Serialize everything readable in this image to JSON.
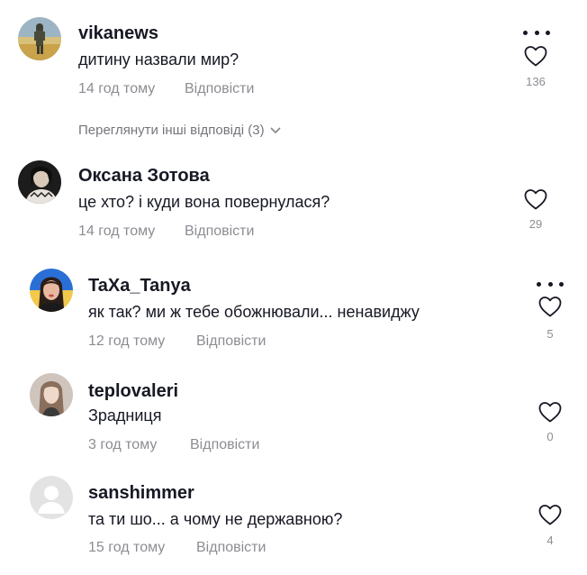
{
  "comments": [
    {
      "username": "vikanews",
      "text": "дитину назвали мир?",
      "time": "14 год тому",
      "reply": "Відповісти",
      "likes": "136",
      "avatar_icon": "soldier-photo-avatar"
    },
    {
      "username": "Оксана Зотова",
      "text": "це хто? і куди вона повернулася?",
      "time": "14 год тому",
      "reply": "Відповісти",
      "likes": "29",
      "avatar_icon": "woman-photo-avatar"
    },
    {
      "username": "TaXa_Tanya",
      "text": "як так? ми ж тебе обожнювали... ненавиджу",
      "time": "12 год тому",
      "reply": "Відповісти",
      "likes": "5",
      "avatar_icon": "woman-flag-photo-avatar"
    },
    {
      "username": "teplovaleri",
      "text": "Зрадниця",
      "time": "3 год тому",
      "reply": "Відповісти",
      "likes": "0",
      "avatar_icon": "woman-photo-avatar"
    },
    {
      "username": "sanshimmer",
      "text": "та ти шо... а чому не державною?",
      "time": "15 год тому",
      "reply": "Відповісти",
      "likes": "4",
      "avatar_icon": "default-user-avatar"
    }
  ],
  "view_more": {
    "label": "Переглянути інші відповіді (3)",
    "icon": "chevron-down-icon"
  },
  "colors": {
    "text": "#161823",
    "muted": "#8a8b91"
  }
}
